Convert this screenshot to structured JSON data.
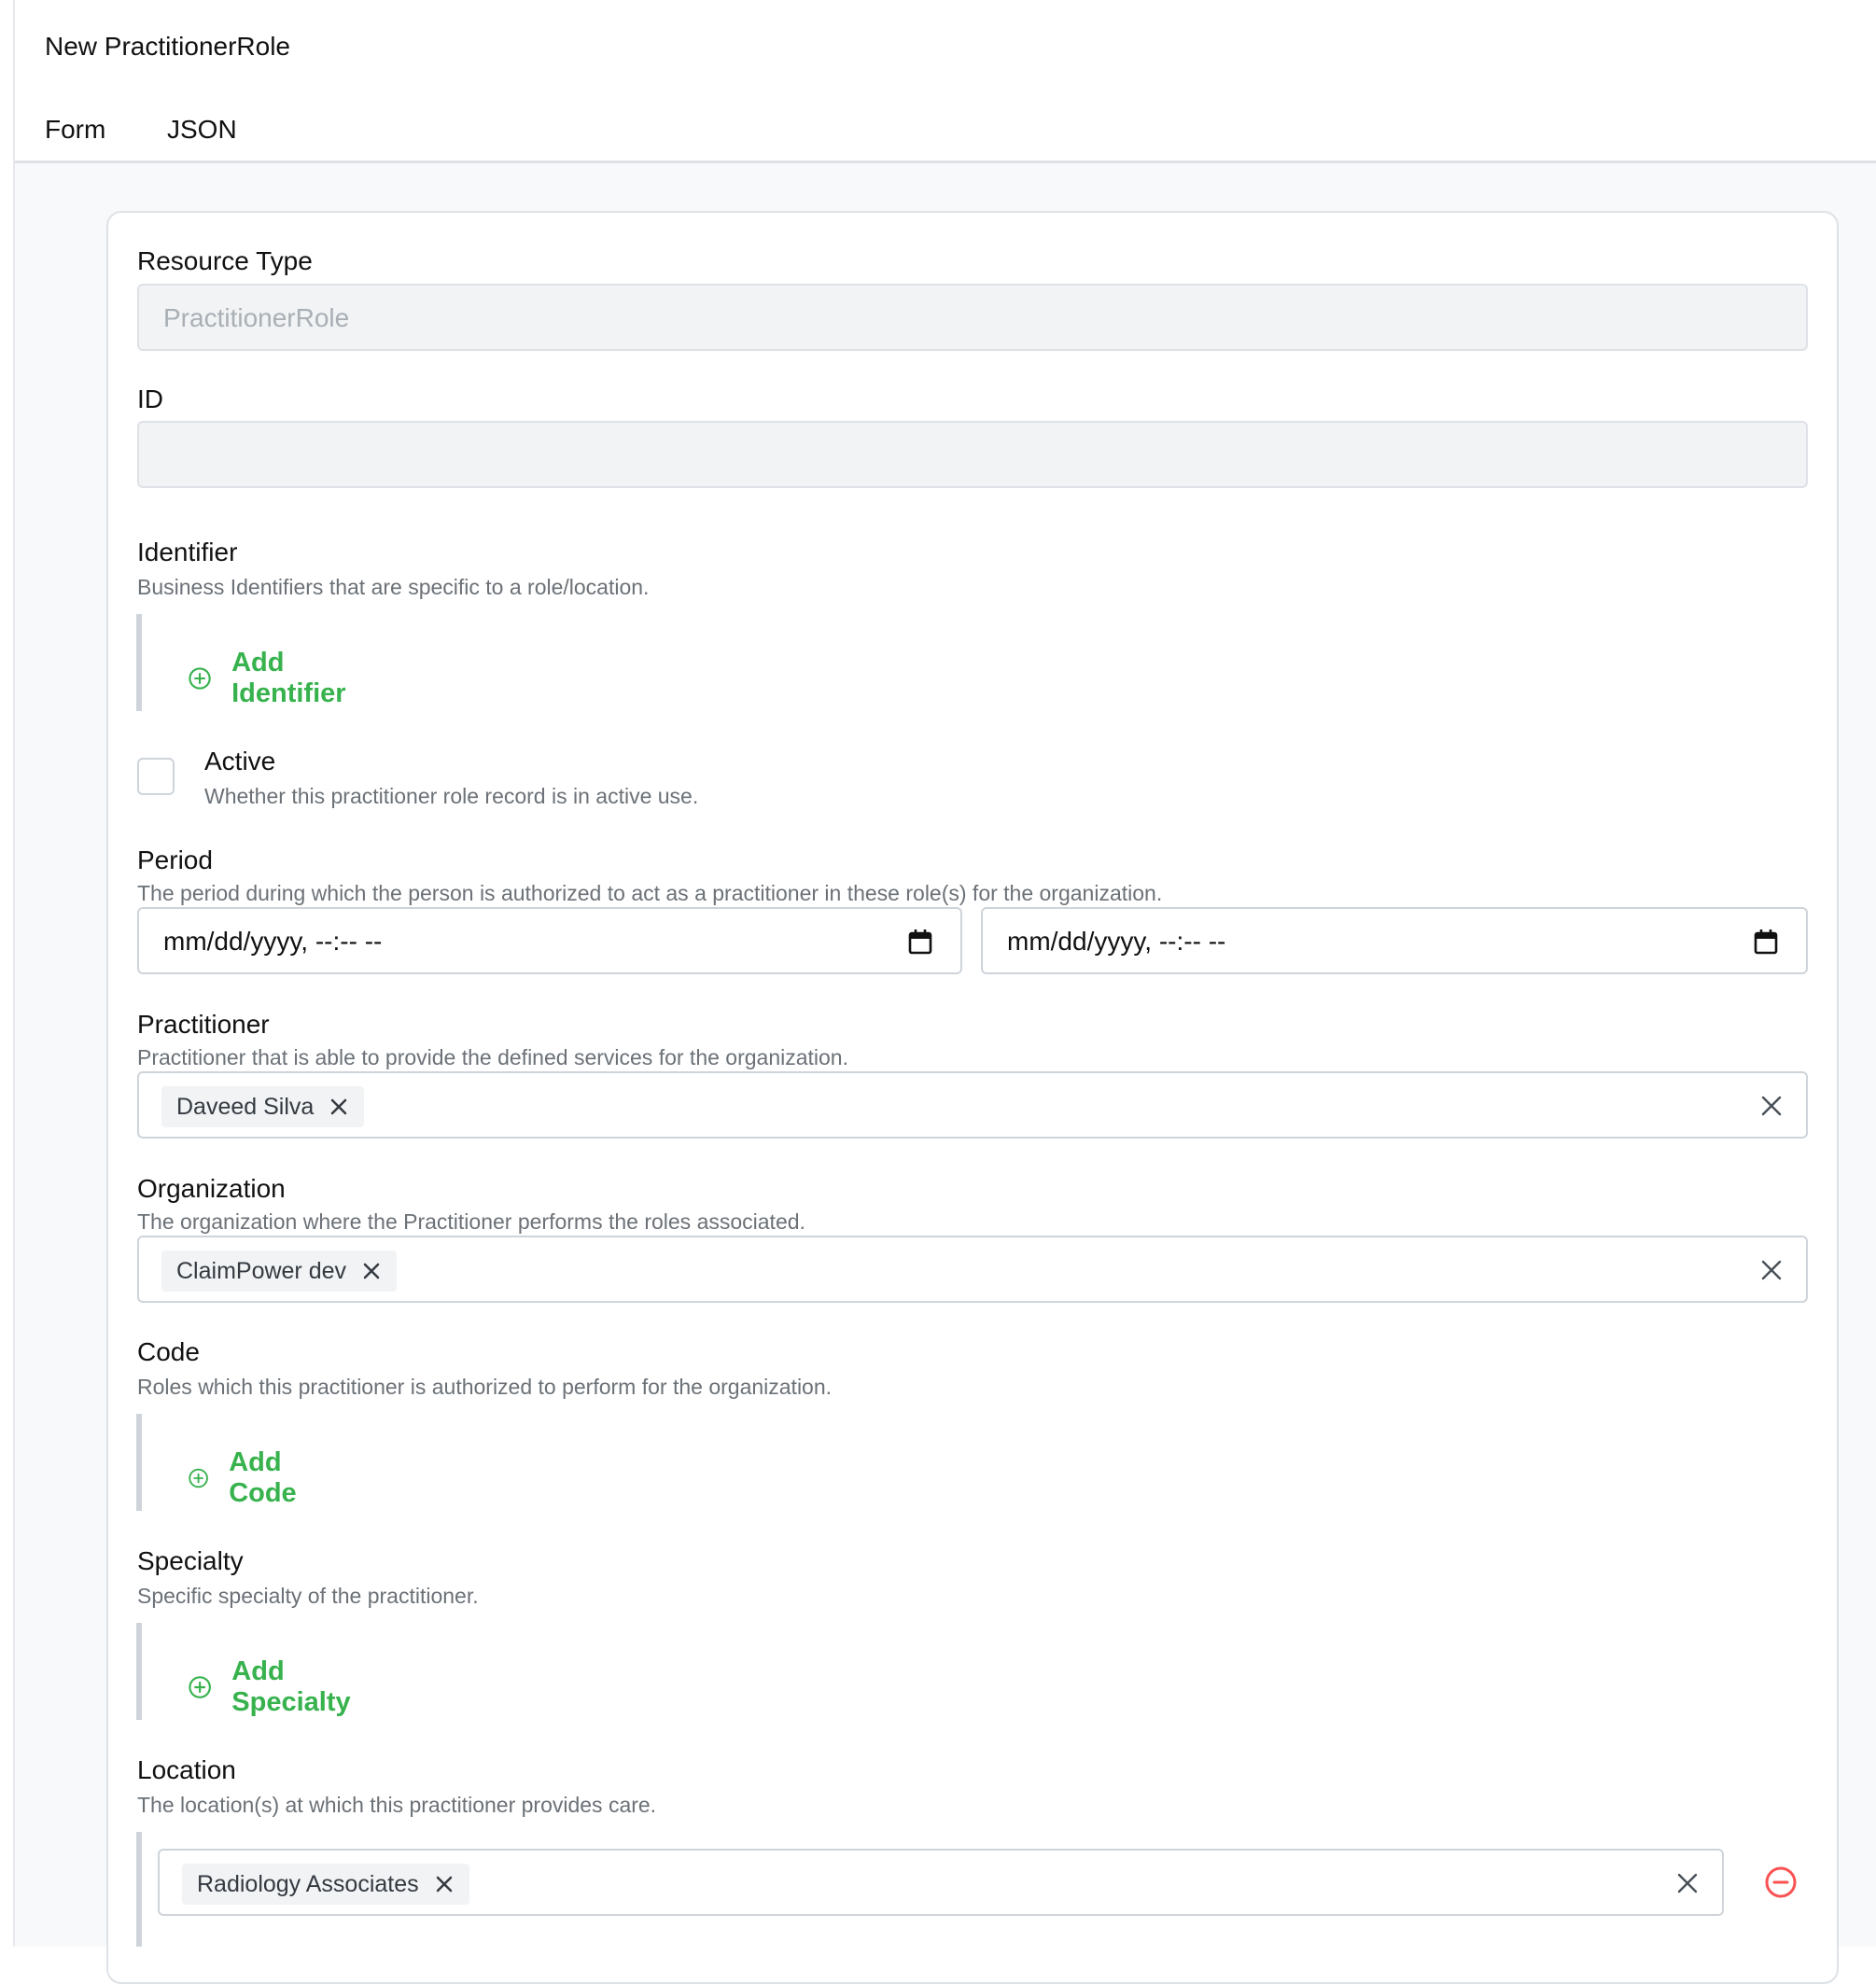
{
  "header": {
    "title": "New PractitionerRole",
    "tabs": {
      "form": "Form",
      "json": "JSON"
    }
  },
  "form": {
    "resource_type": {
      "label": "Resource Type",
      "placeholder": "PractitionerRole"
    },
    "id": {
      "label": "ID",
      "value": ""
    },
    "identifier": {
      "label": "Identifier",
      "description": "Business Identifiers that are specific to a role/location.",
      "add_label": "Add Identifier"
    },
    "active": {
      "label": "Active",
      "description": "Whether this practitioner role record is in active use.",
      "checked": false
    },
    "period": {
      "label": "Period",
      "description": "The period during which the person is authorized to act as a practitioner in these role(s) for the organization.",
      "start_placeholder": "mm/dd/yyyy, --:-- --",
      "end_placeholder": "mm/dd/yyyy, --:-- --"
    },
    "practitioner": {
      "label": "Practitioner",
      "description": "Practitioner that is able to provide the defined services for the organization.",
      "selected": "Daveed Silva"
    },
    "organization": {
      "label": "Organization",
      "description": "The organization where the Practitioner performs the roles associated.",
      "selected": "ClaimPower dev"
    },
    "code": {
      "label": "Code",
      "description": "Roles which this practitioner is authorized to perform for the organization.",
      "add_label": "Add Code"
    },
    "specialty": {
      "label": "Specialty",
      "description": "Specific specialty of the practitioner.",
      "add_label": "Add Specialty"
    },
    "location": {
      "label": "Location",
      "description": "The location(s) at which this practitioner provides care.",
      "selected": "Radiology Associates"
    }
  },
  "colors": {
    "accent_green": "#37b24d",
    "danger_red": "#fa5252",
    "border": "#ced4da",
    "muted_text": "#6b7177"
  },
  "icons": [
    "calendar-icon",
    "add-circle-icon",
    "close-icon",
    "remove-circle-icon"
  ]
}
